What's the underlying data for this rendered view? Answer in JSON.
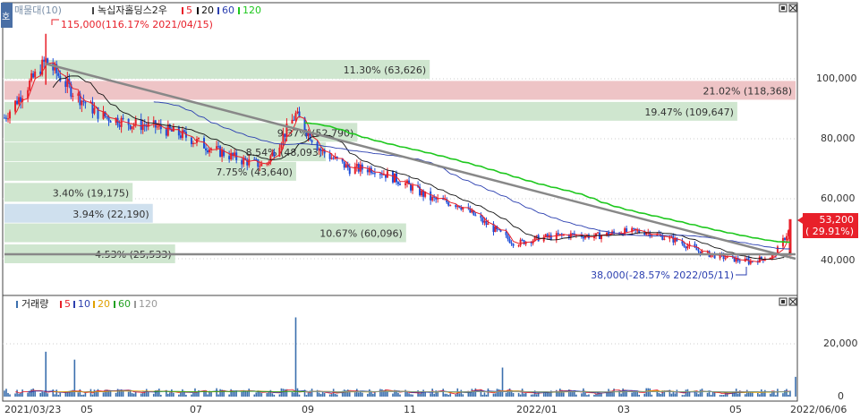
{
  "price_legend": {
    "tag": "호",
    "indicator": "매물대(10)",
    "stock": "녹십자홀딩스2우",
    "ma": [
      "5",
      "20",
      "60",
      "120"
    ]
  },
  "volume_legend": {
    "title": "거래량",
    "ma": [
      "5",
      "10",
      "20",
      "60",
      "120"
    ]
  },
  "price_axis": {
    "ticks": [
      "100,000",
      "80,000",
      "60,000",
      "40,000"
    ]
  },
  "volume_axis": {
    "ticks": [
      "20,000",
      "0"
    ]
  },
  "date_axis": {
    "labels": [
      "2021/03/23",
      "05",
      "07",
      "09",
      "11",
      "2022/01",
      "03",
      "05",
      "2022/06/06"
    ]
  },
  "annotations": {
    "high": "115,000(116.17% 2021/04/15)",
    "low": "38,000(-28.57% 2022/05/11)",
    "current_price": "53,200",
    "current_change": "( 29.91%)"
  },
  "chart_data": [
    {
      "type": "candlestick",
      "title": "녹십자홀딩스2우",
      "x_range": [
        "2021/03/23",
        "2022/06/06"
      ],
      "ylim": [
        28000,
        122000
      ],
      "y_ticks": [
        40000,
        60000,
        80000,
        100000
      ],
      "grid": true,
      "moving_averages": [
        "5",
        "20",
        "60",
        "120"
      ],
      "series_close_approx": [
        {
          "date": "2021/03/23",
          "close": 87000
        },
        {
          "date": "2021/04/15",
          "close": 106000
        },
        {
          "date": "2021/05/01",
          "close": 95000
        },
        {
          "date": "2021/05/15",
          "close": 88000
        },
        {
          "date": "2021/06/01",
          "close": 85000
        },
        {
          "date": "2021/06/15",
          "close": 84000
        },
        {
          "date": "2021/07/01",
          "close": 81000
        },
        {
          "date": "2021/07/15",
          "close": 77000
        },
        {
          "date": "2021/08/01",
          "close": 73000
        },
        {
          "date": "2021/08/15",
          "close": 71000
        },
        {
          "date": "2021/09/01",
          "close": 88000
        },
        {
          "date": "2021/09/15",
          "close": 76000
        },
        {
          "date": "2021/10/01",
          "close": 70000
        },
        {
          "date": "2021/10/15",
          "close": 70000
        },
        {
          "date": "2021/11/01",
          "close": 65000
        },
        {
          "date": "2021/11/15",
          "close": 60000
        },
        {
          "date": "2021/12/01",
          "close": 58000
        },
        {
          "date": "2021/12/15",
          "close": 52000
        },
        {
          "date": "2022/01/01",
          "close": 45000
        },
        {
          "date": "2022/01/15",
          "close": 47000
        },
        {
          "date": "2022/02/01",
          "close": 48000
        },
        {
          "date": "2022/02/15",
          "close": 47500
        },
        {
          "date": "2022/03/01",
          "close": 49000
        },
        {
          "date": "2022/03/15",
          "close": 49000
        },
        {
          "date": "2022/04/01",
          "close": 46000
        },
        {
          "date": "2022/04/15",
          "close": 42000
        },
        {
          "date": "2022/05/01",
          "close": 40000
        },
        {
          "date": "2022/05/11",
          "close": 39000
        },
        {
          "date": "2022/05/25",
          "close": 41000
        },
        {
          "date": "2022/06/06",
          "close": 53200
        }
      ],
      "high": {
        "value": 115000,
        "date": "2021/04/15",
        "pct": 116.17
      },
      "low": {
        "value": 38000,
        "date": "2022/05/11",
        "pct": -28.57
      },
      "last": {
        "value": 53200,
        "pct": 29.91
      },
      "volume_profile": [
        {
          "label": "11.30% (63,626)",
          "pct": 11.3,
          "volume": 63626,
          "price_center": 103000,
          "color": "green"
        },
        {
          "label": "21.02% (118,368)",
          "pct": 21.02,
          "volume": 118368,
          "price_center": 96000,
          "color": "red"
        },
        {
          "label": "19.47% (109,647)",
          "pct": 19.47,
          "volume": 109647,
          "price_center": 89000,
          "color": "green"
        },
        {
          "label": "9.37% (52,790)",
          "pct": 9.37,
          "volume": 52790,
          "price_center": 82000,
          "color": "green"
        },
        {
          "label": "8.54% (48,093)",
          "pct": 8.54,
          "volume": 48093,
          "price_center": 75500,
          "color": "green"
        },
        {
          "label": "7.75% (43,640)",
          "pct": 7.75,
          "volume": 43640,
          "price_center": 69000,
          "color": "green"
        },
        {
          "label": "3.40% (19,175)",
          "pct": 3.4,
          "volume": 19175,
          "price_center": 62000,
          "color": "green"
        },
        {
          "label": "3.94% (22,190)",
          "pct": 3.94,
          "volume": 22190,
          "price_center": 55000,
          "color": "blue"
        },
        {
          "label": "10.67% (60,096)",
          "pct": 10.67,
          "volume": 60096,
          "price_center": 48500,
          "color": "green"
        },
        {
          "label": "4.53% (25,533)",
          "pct": 4.53,
          "volume": 25533,
          "price_center": 41500,
          "color": "green"
        }
      ],
      "trendlines": [
        {
          "from": {
            "date": "2021/04/15",
            "value": 105000
          },
          "to": {
            "date": "2022/06/06",
            "value": 40000
          }
        },
        {
          "from": {
            "date": "2021/03/23",
            "value": 41500
          },
          "to": {
            "date": "2022/06/06",
            "value": 41500
          }
        }
      ]
    },
    {
      "type": "bar",
      "title": "거래량",
      "ylim": [
        0,
        32000
      ],
      "y_ticks": [
        0,
        20000
      ],
      "moving_averages": [
        "5",
        "10",
        "20",
        "60",
        "120"
      ],
      "spikes": [
        {
          "date": "2021/04/15",
          "value": 17000
        },
        {
          "date": "2021/05/01",
          "value": 14000
        },
        {
          "date": "2021/09/01",
          "value": 30000
        },
        {
          "date": "2021/12/25",
          "value": 11000
        },
        {
          "date": "2022/06/06",
          "value": 7500
        }
      ]
    }
  ]
}
